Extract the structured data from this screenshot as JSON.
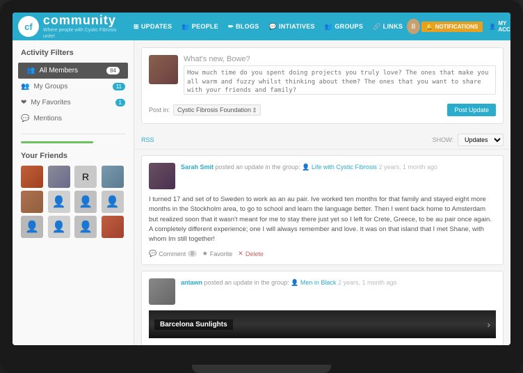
{
  "logo": {
    "initials": "cf",
    "text": "community",
    "tagline": "Where people with Cystic Fibrosis unite!"
  },
  "nav": {
    "items": [
      {
        "label": "Updates",
        "icon": "⊞"
      },
      {
        "label": "People",
        "icon": "👥"
      },
      {
        "label": "Blogs",
        "icon": "✏"
      },
      {
        "label": "Intiatives",
        "icon": "💬"
      },
      {
        "label": "Groups",
        "icon": "👥"
      },
      {
        "label": "Links",
        "icon": "🔗"
      }
    ],
    "notifications_label": "Notifications",
    "account_label": "My Account"
  },
  "sidebar": {
    "activity_filters_title": "Activity Filters",
    "filters": [
      {
        "label": "All Members",
        "count": "84",
        "active": true,
        "icon": ""
      },
      {
        "label": "My Groups",
        "count": "11",
        "active": false,
        "icon": "👥"
      },
      {
        "label": "My Favorites",
        "count": "1",
        "active": false,
        "icon": "❤"
      },
      {
        "label": "Mentions",
        "count": "",
        "active": false,
        "icon": "💬"
      }
    ],
    "friends_title": "Your Friends",
    "friends_count": 12
  },
  "post_box": {
    "prompt": "What's new, Bowe?",
    "placeholder_text": "How much time do you spent doing projects you truly love? The ones that make you all warm and fuzzy whilst thinking about them? The ones that you want to share with your friends and family?",
    "post_in_label": "Post in:",
    "foundation_label": "Cystic Fibrosis Foundation ‡",
    "post_button": "Post Update"
  },
  "feed_controls": {
    "rss_label": "RSS",
    "show_label": "SHOW:",
    "show_option": "Updates"
  },
  "feed_items": [
    {
      "author": "Sarah Smit",
      "action": "posted an update in the group:",
      "group_icon": "👤",
      "group": "Life with Cystic Fibrosis",
      "time": "2 years, 1 month ago",
      "body": "I turned 17 and set of to Sweden to work as an au pair. Ive worked ten months for that family and stayed eight more months in the Stockholm area, to go to school and learn the language better. Then I went back home to Amsterdam but realized soon that it wasn't meant for me to stay there just yet so I left for Crete, Greece, to be au pair once again. A completely different experience; one I will always remember and love. It was on that island that I met Shane, with whom Im still together!",
      "actions": [
        {
          "label": "Comment",
          "icon": "💬",
          "count": "8"
        },
        {
          "label": "Favorite",
          "icon": "★",
          "count": ""
        },
        {
          "label": "Delete",
          "icon": "✕",
          "count": ""
        }
      ],
      "avatar_class": "sarah"
    },
    {
      "author": "antawn",
      "action": "posted an update in the group:",
      "group_icon": "👤",
      "group": "Men in Black",
      "time": "2 years, 1 month ago",
      "body": "",
      "actions": [],
      "avatar_class": "antawn"
    }
  ],
  "barcelona_post": {
    "title": "Barcelona Sunlights"
  }
}
